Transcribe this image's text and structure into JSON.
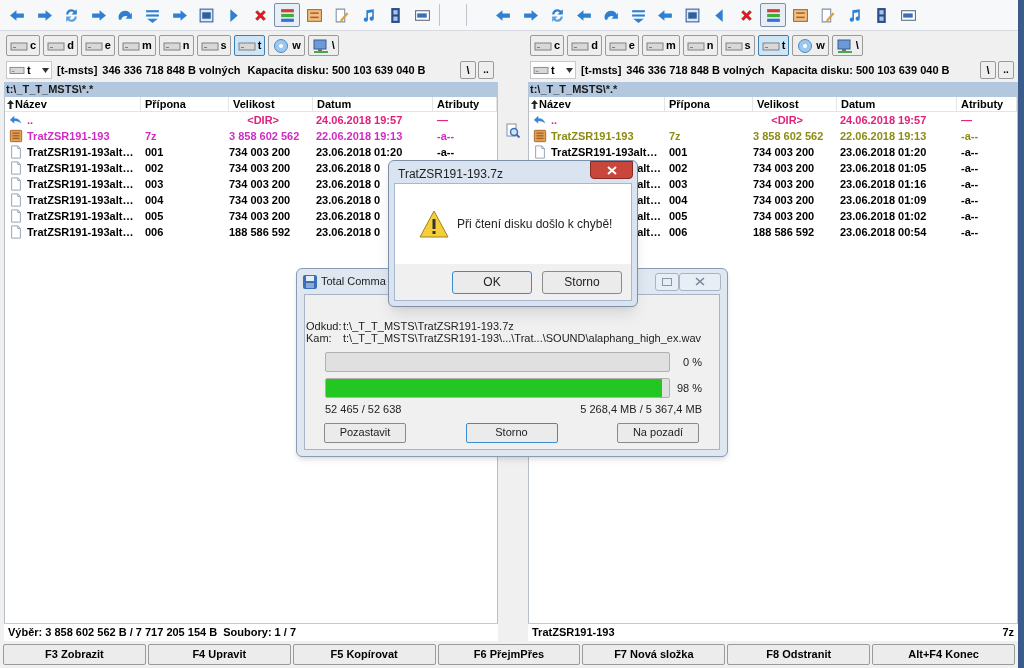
{
  "toolbars": [
    {
      "buttons": [
        {
          "selected": false
        },
        {
          "selected": false
        },
        {
          "selected": false
        },
        {
          "selected": false
        },
        {
          "selected": false
        },
        {
          "selected": false
        },
        {
          "selected": false
        },
        {
          "selected": false
        },
        {
          "selected": false
        },
        {
          "selected": false
        },
        {
          "selected": true
        },
        {
          "selected": false
        },
        {
          "selected": false
        },
        {
          "selected": false
        },
        {
          "selected": false
        },
        {
          "selected": false
        }
      ]
    },
    {
      "buttons": [
        {
          "selected": false
        },
        {
          "selected": false
        },
        {
          "selected": false
        },
        {
          "selected": false
        },
        {
          "selected": false
        },
        {
          "selected": false
        },
        {
          "selected": false
        },
        {
          "selected": false
        },
        {
          "selected": false
        },
        {
          "selected": false
        },
        {
          "selected": true
        },
        {
          "selected": false
        },
        {
          "selected": false
        },
        {
          "selected": false
        },
        {
          "selected": false
        },
        {
          "selected": false
        }
      ]
    }
  ],
  "panels": [
    {
      "drives": [
        {
          "kind": "disk",
          "letter": "c",
          "selected": false
        },
        {
          "kind": "disk",
          "letter": "d",
          "selected": false
        },
        {
          "kind": "disk",
          "letter": "e",
          "selected": false
        },
        {
          "kind": "disk",
          "letter": "m",
          "selected": false
        },
        {
          "kind": "disk",
          "letter": "n",
          "selected": false
        },
        {
          "kind": "disk",
          "letter": "s",
          "selected": false
        },
        {
          "kind": "disk",
          "letter": "t",
          "selected": true
        },
        {
          "kind": "cd",
          "letter": "w",
          "selected": false
        },
        {
          "kind": "network",
          "letter": "\\",
          "selected": false
        }
      ],
      "drive_combo": "t",
      "volume_label": "[t-msts]",
      "free_space": "346 336 718 848 B volných",
      "capacity": "Kapacita disku: 500 103 639 040 B",
      "root_button": "\\",
      "up_button": "..",
      "path": "t:\\_T_T_MSTS\\*.*",
      "columns": [
        {
          "label": "Název",
          "sorted": true
        },
        {
          "label": "Přípona",
          "sorted": false
        },
        {
          "label": "Velikost",
          "sorted": false
        },
        {
          "label": "Datum",
          "sorted": false
        },
        {
          "label": "Atributy",
          "sorted": false
        }
      ],
      "rows": [
        {
          "kind": "parent",
          "name": "..",
          "size": "<DIR>",
          "date": "24.06.2018 19:57",
          "attributes": "—",
          "color": "#e0207a"
        },
        {
          "kind": "archive",
          "name": "TratZSR191-193",
          "ext": "7z",
          "size": "3 858 602 562",
          "date": "22.06.2018 19:13",
          "attributes": "-a--",
          "color": "#d02cc4"
        },
        {
          "kind": "file",
          "name": "TratZSR191-193alt…",
          "ext": "001",
          "size": "734 003 200",
          "date": "23.06.2018 01:20",
          "attributes": "-a--",
          "color": "#000000"
        },
        {
          "kind": "file",
          "name": "TratZSR191-193alt…",
          "ext": "002",
          "size": "734 003 200",
          "date": "23.06.2018 0",
          "color": "#000000"
        },
        {
          "kind": "file",
          "name": "TratZSR191-193alt…",
          "ext": "003",
          "size": "734 003 200",
          "date": "23.06.2018 0",
          "color": "#000000"
        },
        {
          "kind": "file",
          "name": "TratZSR191-193alt…",
          "ext": "004",
          "size": "734 003 200",
          "date": "23.06.2018 0",
          "color": "#000000"
        },
        {
          "kind": "file",
          "name": "TratZSR191-193alt…",
          "ext": "005",
          "size": "734 003 200",
          "date": "23.06.2018 0",
          "color": "#000000"
        },
        {
          "kind": "file",
          "name": "TratZSR191-193alt…",
          "ext": "006",
          "size": "188 586 592",
          "date": "23.06.2018 0",
          "color": "#000000"
        }
      ],
      "status": [
        "Výběr: 3 858 602 562 B / 7 717 205 154 B  Soubory: 1 / 7"
      ]
    },
    {
      "drives": [
        {
          "kind": "disk",
          "letter": "c",
          "selected": false
        },
        {
          "kind": "disk",
          "letter": "d",
          "selected": false
        },
        {
          "kind": "disk",
          "letter": "e",
          "selected": false
        },
        {
          "kind": "disk",
          "letter": "m",
          "selected": false
        },
        {
          "kind": "disk",
          "letter": "n",
          "selected": false
        },
        {
          "kind": "disk",
          "letter": "s",
          "selected": false
        },
        {
          "kind": "disk",
          "letter": "t",
          "selected": true
        },
        {
          "kind": "cd",
          "letter": "w",
          "selected": false
        },
        {
          "kind": "network",
          "letter": "\\",
          "selected": false
        }
      ],
      "drive_combo": "t",
      "volume_label": "[t-msts]",
      "free_space": "346 336 718 848 B volných",
      "capacity": "Kapacita disku: 500 103 639 040 B",
      "root_button": "\\",
      "up_button": "..",
      "path": "t:\\_T_T_MSTS\\*.*",
      "columns": [
        {
          "label": "Název",
          "sorted": true
        },
        {
          "label": "Přípona",
          "sorted": false
        },
        {
          "label": "Velikost",
          "sorted": false
        },
        {
          "label": "Datum",
          "sorted": false
        },
        {
          "label": "Atributy",
          "sorted": false
        }
      ],
      "rows": [
        {
          "kind": "parent",
          "name": "..",
          "size": "<DIR>",
          "date": "24.06.2018 19:57",
          "attributes": "—",
          "color": "#e0207a"
        },
        {
          "kind": "archive",
          "name": "TratZSR191-193",
          "ext": "7z",
          "size": "3 858 602 562",
          "date": "22.06.2018 19:13",
          "attributes": "-a--",
          "color": "#8c8c14"
        },
        {
          "kind": "file",
          "name": "TratZSR191-193alt…",
          "ext": "001",
          "size": "734 003 200",
          "date": "23.06.2018 01:20",
          "attributes": "-a--",
          "color": "#000000"
        },
        {
          "name": "alt…",
          "ext": "002",
          "size": "734 003 200",
          "date": "23.06.2018 01:05",
          "attributes": "-a--",
          "color": "#000000"
        },
        {
          "name": "alt…",
          "ext": "003",
          "size": "734 003 200",
          "date": "23.06.2018 01:16",
          "attributes": "-a--",
          "color": "#000000"
        },
        {
          "name": "alt…",
          "ext": "004",
          "size": "734 003 200",
          "date": "23.06.2018 01:09",
          "attributes": "-a--",
          "color": "#000000"
        },
        {
          "name": "alt…",
          "ext": "005",
          "size": "734 003 200",
          "date": "23.06.2018 01:02",
          "attributes": "-a--",
          "color": "#000000"
        },
        {
          "name": "alt…",
          "ext": "006",
          "size": "188 586 592",
          "date": "23.06.2018 00:54",
          "attributes": "-a--",
          "color": "#000000"
        }
      ],
      "status": [
        "TratZSR191-193",
        "7z"
      ]
    }
  ],
  "function_keys": [
    "F3 Zobrazit",
    "F4 Upravit",
    "F5 Kopírovat",
    "F6 PřejmPřes",
    "F7 Nová složka",
    "F8 Odstranit",
    "Alt+F4 Konec"
  ],
  "progress_dialog": {
    "title": "Total Comma",
    "from_label": "Odkud:",
    "from": "t:\\_T_T_MSTS\\TratZSR191-193.7z",
    "to_label": "Kam:",
    "to": "t:\\_T_T_MSTS\\TratZSR191-193\\...\\Trat...\\SOUND\\alaphang_high_ex.wav",
    "bars": [
      {
        "level": 0,
        "reading": "0 %"
      },
      {
        "level": 0.98,
        "reading": "98 %"
      }
    ],
    "files_count": "52 465 / 52 638",
    "bytes": "5 268,4 MB / 5 367,4 MB",
    "buttons": [
      {
        "label": "Pozastavit",
        "selected": false
      },
      {
        "label": "Storno",
        "selected": true
      },
      {
        "label": "Na pozadí",
        "selected": false
      }
    ]
  },
  "error_dialog": {
    "title": "TratZSR191-193.7z",
    "message": "Při čtení disku došlo k chybě!",
    "buttons": [
      {
        "label": "OK",
        "selected": true
      },
      {
        "label": "Storno",
        "selected": false
      }
    ]
  }
}
